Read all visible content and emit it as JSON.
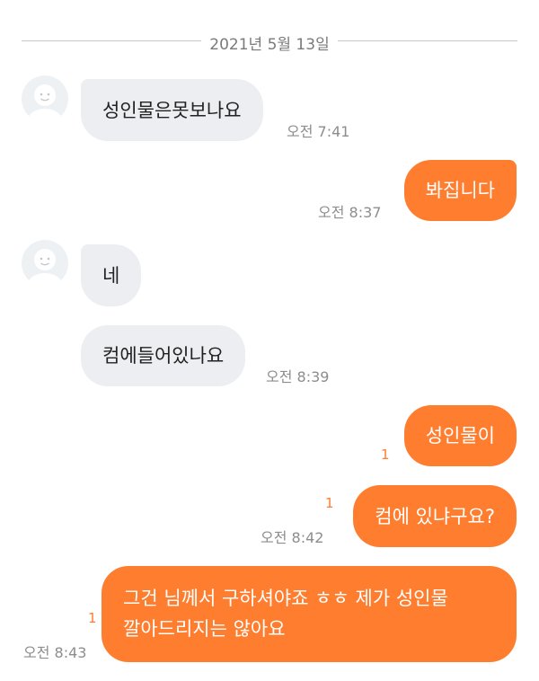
{
  "date_separator": "2021년 5월 13일",
  "colors": {
    "accent": "#ff7d2e",
    "incoming_bubble": "#eceef1",
    "background": "#ffffff"
  },
  "icons": {
    "avatar": "default-profile-icon"
  },
  "messages": [
    {
      "side": "incoming",
      "text": "성인물은못보나요",
      "time": "오전 7:41"
    },
    {
      "side": "outgoing",
      "text": "봐집니다",
      "time": "오전 8:37"
    },
    {
      "side": "incoming",
      "text": "네"
    },
    {
      "side": "incoming",
      "text": "컴에들어있나요",
      "time": "오전 8:39"
    },
    {
      "side": "outgoing",
      "text": "성인물이",
      "unread": "1"
    },
    {
      "side": "outgoing",
      "text": "컴에 있냐구요?",
      "unread": "1",
      "time": "오전 8:42"
    },
    {
      "side": "outgoing",
      "lines": [
        "그건 님께서 구하셔야죠 ㅎㅎ 제가 성인물",
        "깔아드리지는 않아요"
      ],
      "unread": "1",
      "time": "오전 8:43"
    }
  ]
}
